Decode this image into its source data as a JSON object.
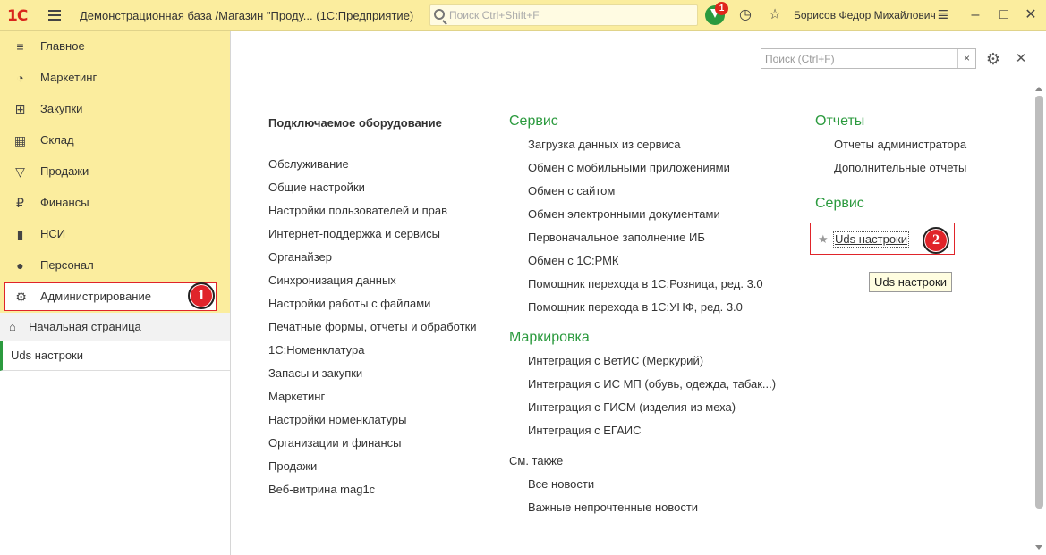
{
  "header": {
    "logo": "1С",
    "title": "Демонстрационная база /Магазин \"Проду...   (1С:Предприятие)",
    "search_placeholder": "Поиск Ctrl+Shift+F",
    "notification_count": "1",
    "user_name": "Борисов Федор Михайлович",
    "icons": [
      "logo-1c",
      "burger-icon",
      "search-icon",
      "notification-icon",
      "history-icon",
      "favorite-star-icon",
      "settings-menu-icon",
      "minimize-icon",
      "maximize-icon",
      "close-icon"
    ]
  },
  "sidebar": {
    "items": [
      {
        "label": "Главное",
        "icon": "menu-lines-icon"
      },
      {
        "label": "Маркетинг",
        "icon": "pie-chart-icon"
      },
      {
        "label": "Закупки",
        "icon": "cart-icon"
      },
      {
        "label": "Склад",
        "icon": "grid-icon"
      },
      {
        "label": "Продажи",
        "icon": "basket-icon"
      },
      {
        "label": "Финансы",
        "icon": "ruble-coin-icon"
      },
      {
        "label": "НСИ",
        "icon": "books-icon"
      },
      {
        "label": "Персонал",
        "icon": "person-icon"
      },
      {
        "label": "Администрирование",
        "icon": "gear-icon",
        "active": true
      }
    ],
    "home": "Начальная страница",
    "open_tab": "Uds настроки"
  },
  "callouts": {
    "first": "1",
    "second": "2"
  },
  "main": {
    "search_placeholder": "Поиск (Ctrl+F)",
    "clear": "×",
    "col1": {
      "heading": "Подключаемое оборудование",
      "items": [
        "Обслуживание",
        "Общие настройки",
        "Настройки пользователей и прав",
        "Интернет-поддержка и сервисы",
        "Органайзер",
        "Синхронизация данных",
        "Настройки работы с файлами",
        "Печатные формы, отчеты и обработки",
        "1С:Номенклатура",
        "Запасы и закупки",
        "Маркетинг",
        "Настройки номенклатуры",
        "Организации и финансы",
        "Продажи",
        "Веб-витрина mag1c"
      ]
    },
    "col2": {
      "service_title": "Сервис",
      "service_items": [
        "Загрузка данных из сервиса",
        "Обмен с мобильными приложениями",
        "Обмен с сайтом",
        "Обмен электронными документами",
        "Первоначальное заполнение ИБ",
        "Обмен с 1С:РМК",
        "Помощник перехода в 1С:Розница, ред. 3.0",
        "Помощник перехода в 1С:УНФ, ред. 3.0"
      ],
      "marking_title": "Маркировка",
      "marking_items": [
        "Интеграция с ВетИС (Меркурий)",
        "Интеграция с ИС МП (обувь, одежда, табак...)",
        "Интеграция с ГИСМ (изделия из меха)",
        "Интеграция с ЕГАИС"
      ],
      "see_also_title": "См. также",
      "see_also_items": [
        "Все новости",
        "Важные непрочтенные новости"
      ]
    },
    "col3": {
      "reports_title": "Отчеты",
      "reports_items": [
        "Отчеты администратора",
        "Дополнительные отчеты"
      ],
      "service_title": "Сервис",
      "uds_link": "Uds настроки",
      "tooltip": "Uds настроки"
    }
  }
}
